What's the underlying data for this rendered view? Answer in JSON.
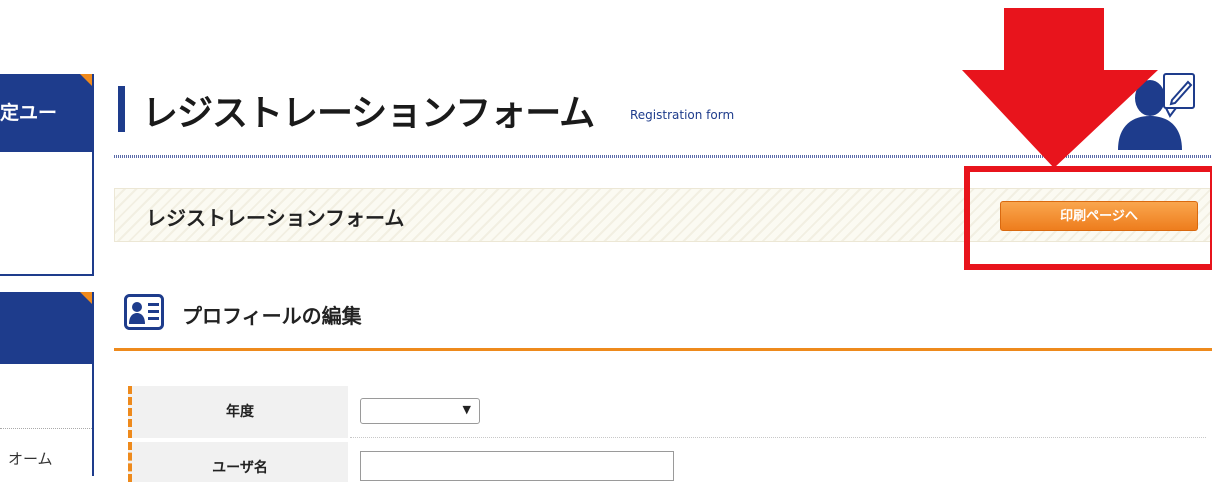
{
  "sidebar": {
    "card1_label": "定ユー",
    "card2_item": "オーム"
  },
  "header": {
    "title_jp": "レジストレーションフォーム",
    "title_en": "Registration form"
  },
  "subheader": {
    "title": "レジストレーションフォーム",
    "print_button": "印刷ページへ"
  },
  "section": {
    "title": "プロフィールの編集",
    "fields": [
      {
        "label": "年度",
        "value": ""
      },
      {
        "label": "ユーザ名",
        "value": ""
      }
    ]
  },
  "icons": {
    "user_edit": "user-edit-icon",
    "profile_card": "profile-card-icon",
    "select_arrow": "▼"
  },
  "colors": {
    "brand_navy": "#1e3c8c",
    "accent_orange": "#ee8a1c",
    "highlight_red": "#e8141c"
  }
}
